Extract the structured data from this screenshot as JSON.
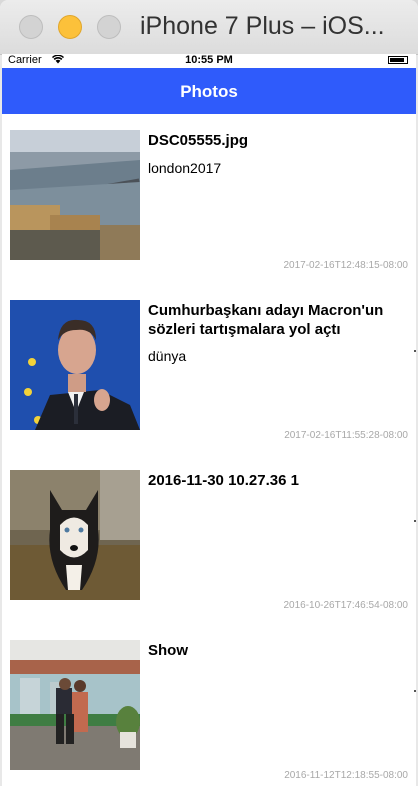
{
  "window": {
    "title": "iPhone 7 Plus – iOS..."
  },
  "status_bar": {
    "carrier": "Carrier",
    "time": "10:55 PM",
    "battery_level": 0.9
  },
  "nav": {
    "title": "Photos",
    "color": "#2f5bfb"
  },
  "photos": [
    {
      "title": "DSC05555.jpg",
      "subtitle": "london2017",
      "date": "2017-02-16T12:48:15-08:00"
    },
    {
      "title": "Cumhurbaşkanı adayı Macron'un sözleri tartışmalara yol açtı",
      "subtitle": "dünya",
      "date": "2017-02-16T11:55:28-08:00"
    },
    {
      "title": "2016-11-30 10.27.36 1",
      "subtitle": "",
      "date": "2016-10-26T17:46:54-08:00"
    },
    {
      "title": "Show",
      "subtitle": "",
      "date": "2016-11-12T12:18:55-08:00"
    }
  ]
}
